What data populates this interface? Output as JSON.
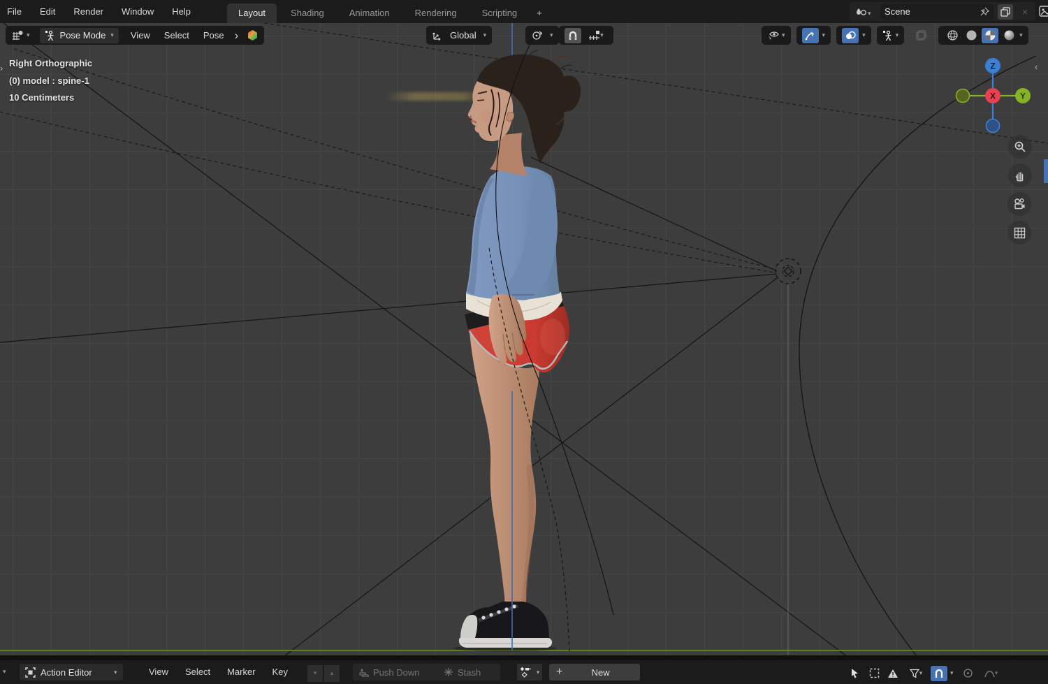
{
  "topbar": {
    "menus": [
      "File",
      "Edit",
      "Render",
      "Window",
      "Help"
    ],
    "tabs": [
      "Layout",
      "Shading",
      "Animation",
      "Rendering",
      "Scripting"
    ],
    "add_tab": "+",
    "scene_name": "Scene",
    "close_x": "×"
  },
  "header": {
    "mode": "Pose Mode",
    "view": "View",
    "select": "Select",
    "pose": "Pose",
    "breadcrumb": "›",
    "orientation": "Global"
  },
  "viewport": {
    "view_label": "Right Orthographic",
    "context_label": "(0) model : spine-1",
    "scale_label": "10 Centimeters",
    "axis_z": "Z",
    "axis_x": "X",
    "axis_y": "Y"
  },
  "dopesheet": {
    "editor": "Action Editor",
    "view": "View",
    "select": "Select",
    "marker": "Marker",
    "key": "Key",
    "down_arrow": "▾",
    "up_arrow": "▴",
    "push_down": "Push Down",
    "stash": "Stash",
    "plus": "+",
    "new_label": "New"
  },
  "colors": {
    "accent_blue": "#4772b3",
    "axis_x_red": "#e8414f",
    "axis_y_green": "#84b325",
    "axis_z_blue": "#3b7fd6",
    "ground_green": "#5d8f1e",
    "viewport_bg": "#3d3d3d"
  }
}
